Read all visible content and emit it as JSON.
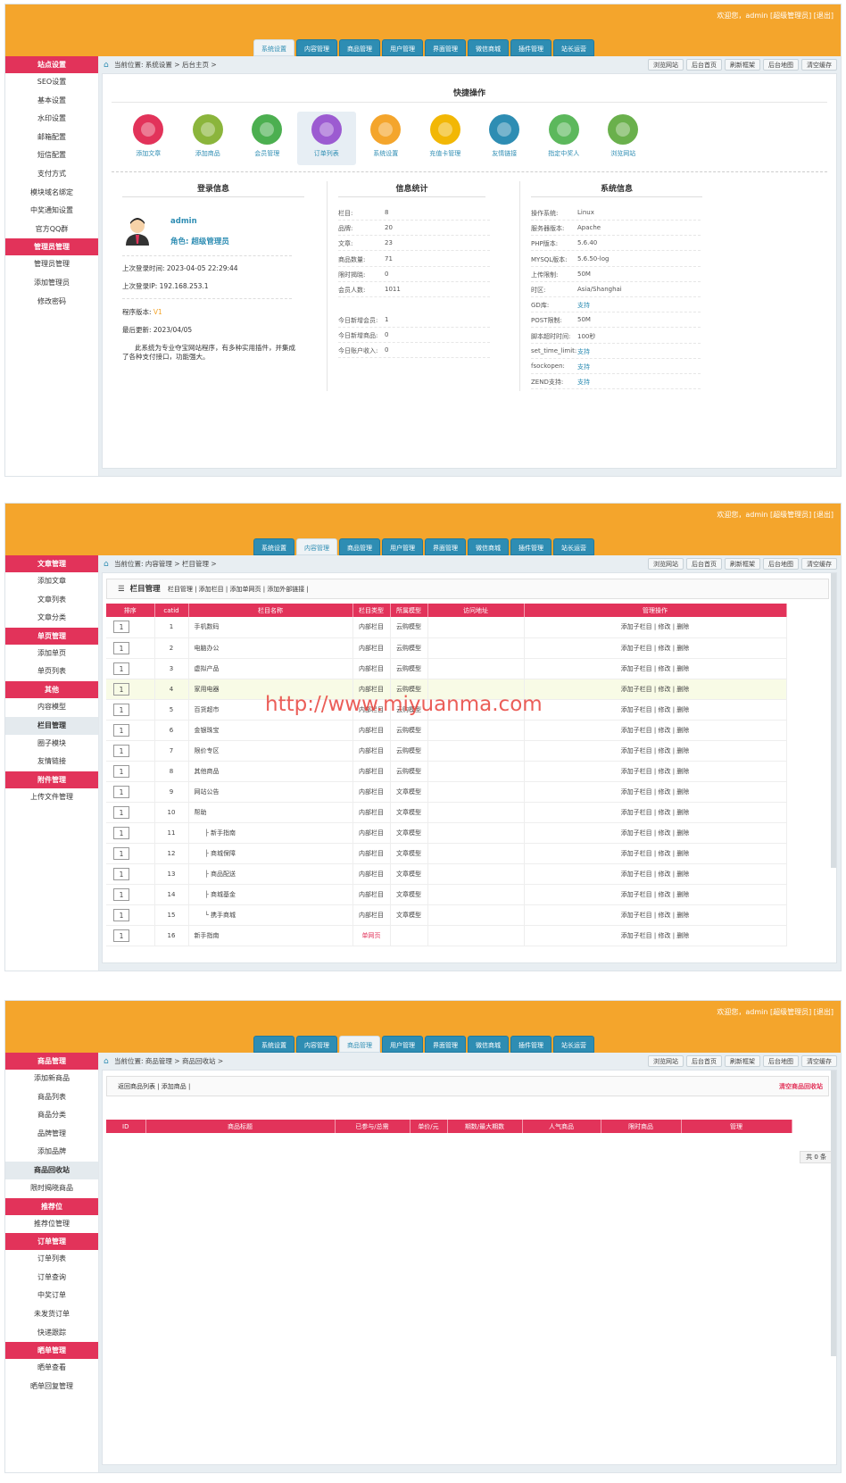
{
  "header": {
    "welcome": "欢迎您，admin [超级管理员] [退出]",
    "tabs": [
      "系统设置",
      "内容管理",
      "商品管理",
      "用户管理",
      "界面管理",
      "微信商城",
      "插件管理",
      "站长运营"
    ]
  },
  "crumb_buttons": [
    "浏览网站",
    "后台首页",
    "刷新框架",
    "后台地图",
    "清空缓存"
  ],
  "panel1": {
    "breadcrumb": "当前位置: 系统设置 > 后台主页 >",
    "sidebar": [
      {
        "type": "head",
        "label": "站点设置"
      },
      {
        "type": "item",
        "label": "SEO设置"
      },
      {
        "type": "item",
        "label": "基本设置"
      },
      {
        "type": "item",
        "label": "水印设置"
      },
      {
        "type": "item",
        "label": "邮箱配置"
      },
      {
        "type": "item",
        "label": "短信配置"
      },
      {
        "type": "item",
        "label": "支付方式"
      },
      {
        "type": "item",
        "label": "模块域名绑定"
      },
      {
        "type": "item",
        "label": "中奖通知设置"
      },
      {
        "type": "item",
        "label": "官方QQ群"
      },
      {
        "type": "head",
        "label": "管理员管理"
      },
      {
        "type": "item",
        "label": "管理员管理"
      },
      {
        "type": "item",
        "label": "添加管理员"
      },
      {
        "type": "item",
        "label": "修改密码"
      }
    ],
    "quick_title": "快捷操作",
    "quick": [
      {
        "label": "添加文章",
        "icon": "article-icon",
        "color": "#e2335a"
      },
      {
        "label": "添加商品",
        "icon": "sunflower-icon",
        "color": "#8bb53c"
      },
      {
        "label": "会员管理",
        "icon": "members-icon",
        "color": "#4caf50"
      },
      {
        "label": "订单列表",
        "icon": "order-icon",
        "color": "#9c5bd1"
      },
      {
        "label": "系统设置",
        "icon": "gear-icon",
        "color": "#f4a52c"
      },
      {
        "label": "充值卡管理",
        "icon": "coin-icon",
        "color": "#f2b705"
      },
      {
        "label": "友情链接",
        "icon": "globe-icon",
        "color": "#2e8db3"
      },
      {
        "label": "指定中奖人",
        "icon": "person-icon",
        "color": "#5cb85c"
      },
      {
        "label": "浏览网站",
        "icon": "birdhouse-icon",
        "color": "#6ab04c"
      }
    ],
    "login": {
      "title": "登录信息",
      "username": "admin",
      "role": "角色: 超级管理员",
      "last_time": "上次登录时间: 2023-04-05 22:29:44",
      "last_ip": "上次登录IP: 192.168.253.1",
      "version_label": "程序版本: ",
      "version": "V1",
      "updated": "最后更新: 2023/04/05",
      "desc": "此系统为专业夺宝网站程序，有多种实用插件，并集成了各种支付接口，功能强大。"
    },
    "stats": {
      "title": "信息统计",
      "rows": [
        {
          "k": "栏目:",
          "v": "8"
        },
        {
          "k": "品牌:",
          "v": "20"
        },
        {
          "k": "文章:",
          "v": "23"
        },
        {
          "k": "商品数量:",
          "v": "71"
        },
        {
          "k": "限时揭晓:",
          "v": "0"
        },
        {
          "k": "会员人数:",
          "v": "1011"
        }
      ],
      "today": [
        {
          "k": "今日新增会员:",
          "v": "1"
        },
        {
          "k": "今日新增商品:",
          "v": "0"
        },
        {
          "k": "今日账户收入:",
          "v": "0"
        }
      ]
    },
    "sys": {
      "title": "系统信息",
      "rows": [
        {
          "k": "操作系统:",
          "v": "Linux",
          "blue": false
        },
        {
          "k": "服务器版本:",
          "v": "Apache",
          "blue": false
        },
        {
          "k": "PHP版本:",
          "v": "5.6.40",
          "blue": false
        },
        {
          "k": "MYSQL版本:",
          "v": "5.6.50-log",
          "blue": false
        },
        {
          "k": "上传限制:",
          "v": "50M",
          "blue": false
        },
        {
          "k": "时区:",
          "v": "Asia/Shanghai",
          "blue": false
        },
        {
          "k": "GD库:",
          "v": "支持",
          "blue": true
        },
        {
          "k": "POST限制:",
          "v": "50M",
          "blue": false
        },
        {
          "k": "脚本超时时间:",
          "v": "100秒",
          "blue": false
        },
        {
          "k": "set_time_limit:",
          "v": "支持",
          "blue": true
        },
        {
          "k": "fsockopen:",
          "v": "支持",
          "blue": true
        },
        {
          "k": "ZEND支持:",
          "v": "支持",
          "blue": true
        }
      ]
    }
  },
  "panel2": {
    "breadcrumb": "当前位置: 内容管理 > 栏目管理 >",
    "sidebar": [
      {
        "type": "head",
        "label": "文章管理"
      },
      {
        "type": "item",
        "label": "添加文章"
      },
      {
        "type": "item",
        "label": "文章列表"
      },
      {
        "type": "item",
        "label": "文章分类"
      },
      {
        "type": "head",
        "label": "单页管理"
      },
      {
        "type": "item",
        "label": "添加单页"
      },
      {
        "type": "item",
        "label": "单页列表"
      },
      {
        "type": "head",
        "label": "其他"
      },
      {
        "type": "item",
        "label": "内容模型"
      },
      {
        "type": "sub",
        "label": "栏目管理"
      },
      {
        "type": "item",
        "label": "圈子模块"
      },
      {
        "type": "item",
        "label": "友情链接"
      },
      {
        "type": "head",
        "label": "附件管理"
      },
      {
        "type": "item",
        "label": "上传文件管理"
      }
    ],
    "toolbar_title": "栏目管理",
    "toolbar_links": "栏目管理 | 添加栏目 | 添加单网页 | 添加外部链接 |",
    "columns": [
      "排序",
      "catid",
      "栏目名称",
      "栏目类型",
      "所属模型",
      "访问地址",
      "管理操作"
    ],
    "ops": "添加子栏目 | 修改 | 删除",
    "rows": [
      {
        "sort": "1",
        "id": "1",
        "name": "手机数码",
        "type": "内部栏目",
        "model": "云购模型",
        "red": false
      },
      {
        "sort": "1",
        "id": "2",
        "name": "电脑办公",
        "type": "内部栏目",
        "model": "云购模型",
        "red": false
      },
      {
        "sort": "1",
        "id": "3",
        "name": "虚拟产品",
        "type": "内部栏目",
        "model": "云购模型",
        "red": false
      },
      {
        "sort": "1",
        "id": "4",
        "name": "家用电器",
        "type": "内部栏目",
        "model": "云购模型",
        "red": false,
        "hl": true
      },
      {
        "sort": "1",
        "id": "5",
        "name": "百货超市",
        "type": "内部栏目",
        "model": "云购模型",
        "red": false
      },
      {
        "sort": "1",
        "id": "6",
        "name": "金银珠宝",
        "type": "内部栏目",
        "model": "云购模型",
        "red": false
      },
      {
        "sort": "1",
        "id": "7",
        "name": "限价专区",
        "type": "内部栏目",
        "model": "云购模型",
        "red": false
      },
      {
        "sort": "1",
        "id": "8",
        "name": "其他商品",
        "type": "内部栏目",
        "model": "云购模型",
        "red": false
      },
      {
        "sort": "1",
        "id": "9",
        "name": "网站公告",
        "type": "内部栏目",
        "model": "文章模型",
        "red": false
      },
      {
        "sort": "1",
        "id": "10",
        "name": "帮助",
        "type": "内部栏目",
        "model": "文章模型",
        "red": false
      },
      {
        "sort": "1",
        "id": "11",
        "name": "├ 新手指南",
        "type": "内部栏目",
        "model": "文章模型",
        "red": false,
        "indent": true
      },
      {
        "sort": "1",
        "id": "12",
        "name": "├ 商城保障",
        "type": "内部栏目",
        "model": "文章模型",
        "red": false,
        "indent": true
      },
      {
        "sort": "1",
        "id": "13",
        "name": "├ 商品配送",
        "type": "内部栏目",
        "model": "文章模型",
        "red": false,
        "indent": true
      },
      {
        "sort": "1",
        "id": "14",
        "name": "├ 商城基金",
        "type": "内部栏目",
        "model": "文章模型",
        "red": false,
        "indent": true
      },
      {
        "sort": "1",
        "id": "15",
        "name": "└ 携手商城",
        "type": "内部栏目",
        "model": "文章模型",
        "red": false,
        "indent": true
      },
      {
        "sort": "1",
        "id": "16",
        "name": "新手指南",
        "type": "单网页",
        "model": "",
        "red": true
      }
    ]
  },
  "watermark": "http://www.miyuanma.com",
  "panel3": {
    "breadcrumb": "当前位置: 商品管理 > 商品回收站 >",
    "sidebar": [
      {
        "type": "head",
        "label": "商品管理"
      },
      {
        "type": "item",
        "label": "添加新商品"
      },
      {
        "type": "item",
        "label": "商品列表"
      },
      {
        "type": "item",
        "label": "商品分类"
      },
      {
        "type": "item",
        "label": "品牌管理"
      },
      {
        "type": "item",
        "label": "添加品牌"
      },
      {
        "type": "sub",
        "label": "商品回收站"
      },
      {
        "type": "item",
        "label": "限时揭晓商品"
      },
      {
        "type": "head",
        "label": "推荐位"
      },
      {
        "type": "item",
        "label": "推荐位管理"
      },
      {
        "type": "head",
        "label": "订单管理"
      },
      {
        "type": "item",
        "label": "订单列表"
      },
      {
        "type": "item",
        "label": "订单查询"
      },
      {
        "type": "item",
        "label": "中奖订单"
      },
      {
        "type": "item",
        "label": "未发货订单"
      },
      {
        "type": "item",
        "label": "快递跟踪"
      },
      {
        "type": "head",
        "label": "晒单管理"
      },
      {
        "type": "item",
        "label": "晒单查看"
      },
      {
        "type": "item",
        "label": "晒单回复管理"
      }
    ],
    "toolbar_links": "返回商品列表 | 添加商品 |",
    "clear_label": "清空商品回收站",
    "columns": [
      "ID",
      "商品标题",
      "已参与/总需",
      "单价/元",
      "期数/最大期数",
      "人气商品",
      "限时商品",
      "管理"
    ],
    "total": "共 0 条"
  }
}
